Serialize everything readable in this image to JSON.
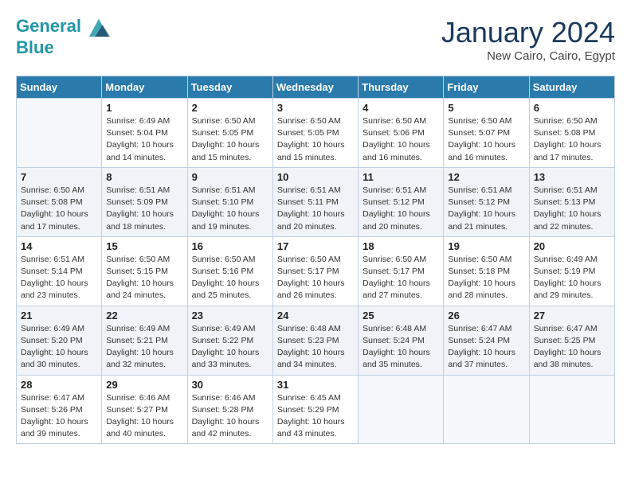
{
  "header": {
    "logo_line1": "General",
    "logo_line2": "Blue",
    "month_title": "January 2024",
    "location": "New Cairo, Cairo, Egypt"
  },
  "weekdays": [
    "Sunday",
    "Monday",
    "Tuesday",
    "Wednesday",
    "Thursday",
    "Friday",
    "Saturday"
  ],
  "weeks": [
    [
      {
        "day": "",
        "empty": true
      },
      {
        "day": "1",
        "sunrise": "6:49 AM",
        "sunset": "5:04 PM",
        "daylight": "10 hours and 14 minutes."
      },
      {
        "day": "2",
        "sunrise": "6:50 AM",
        "sunset": "5:05 PM",
        "daylight": "10 hours and 15 minutes."
      },
      {
        "day": "3",
        "sunrise": "6:50 AM",
        "sunset": "5:05 PM",
        "daylight": "10 hours and 15 minutes."
      },
      {
        "day": "4",
        "sunrise": "6:50 AM",
        "sunset": "5:06 PM",
        "daylight": "10 hours and 16 minutes."
      },
      {
        "day": "5",
        "sunrise": "6:50 AM",
        "sunset": "5:07 PM",
        "daylight": "10 hours and 16 minutes."
      },
      {
        "day": "6",
        "sunrise": "6:50 AM",
        "sunset": "5:08 PM",
        "daylight": "10 hours and 17 minutes."
      }
    ],
    [
      {
        "day": "7",
        "sunrise": "6:50 AM",
        "sunset": "5:08 PM",
        "daylight": "10 hours and 17 minutes."
      },
      {
        "day": "8",
        "sunrise": "6:51 AM",
        "sunset": "5:09 PM",
        "daylight": "10 hours and 18 minutes."
      },
      {
        "day": "9",
        "sunrise": "6:51 AM",
        "sunset": "5:10 PM",
        "daylight": "10 hours and 19 minutes."
      },
      {
        "day": "10",
        "sunrise": "6:51 AM",
        "sunset": "5:11 PM",
        "daylight": "10 hours and 20 minutes."
      },
      {
        "day": "11",
        "sunrise": "6:51 AM",
        "sunset": "5:12 PM",
        "daylight": "10 hours and 20 minutes."
      },
      {
        "day": "12",
        "sunrise": "6:51 AM",
        "sunset": "5:12 PM",
        "daylight": "10 hours and 21 minutes."
      },
      {
        "day": "13",
        "sunrise": "6:51 AM",
        "sunset": "5:13 PM",
        "daylight": "10 hours and 22 minutes."
      }
    ],
    [
      {
        "day": "14",
        "sunrise": "6:51 AM",
        "sunset": "5:14 PM",
        "daylight": "10 hours and 23 minutes."
      },
      {
        "day": "15",
        "sunrise": "6:50 AM",
        "sunset": "5:15 PM",
        "daylight": "10 hours and 24 minutes."
      },
      {
        "day": "16",
        "sunrise": "6:50 AM",
        "sunset": "5:16 PM",
        "daylight": "10 hours and 25 minutes."
      },
      {
        "day": "17",
        "sunrise": "6:50 AM",
        "sunset": "5:17 PM",
        "daylight": "10 hours and 26 minutes."
      },
      {
        "day": "18",
        "sunrise": "6:50 AM",
        "sunset": "5:17 PM",
        "daylight": "10 hours and 27 minutes."
      },
      {
        "day": "19",
        "sunrise": "6:50 AM",
        "sunset": "5:18 PM",
        "daylight": "10 hours and 28 minutes."
      },
      {
        "day": "20",
        "sunrise": "6:49 AM",
        "sunset": "5:19 PM",
        "daylight": "10 hours and 29 minutes."
      }
    ],
    [
      {
        "day": "21",
        "sunrise": "6:49 AM",
        "sunset": "5:20 PM",
        "daylight": "10 hours and 30 minutes."
      },
      {
        "day": "22",
        "sunrise": "6:49 AM",
        "sunset": "5:21 PM",
        "daylight": "10 hours and 32 minutes."
      },
      {
        "day": "23",
        "sunrise": "6:49 AM",
        "sunset": "5:22 PM",
        "daylight": "10 hours and 33 minutes."
      },
      {
        "day": "24",
        "sunrise": "6:48 AM",
        "sunset": "5:23 PM",
        "daylight": "10 hours and 34 minutes."
      },
      {
        "day": "25",
        "sunrise": "6:48 AM",
        "sunset": "5:24 PM",
        "daylight": "10 hours and 35 minutes."
      },
      {
        "day": "26",
        "sunrise": "6:47 AM",
        "sunset": "5:24 PM",
        "daylight": "10 hours and 37 minutes."
      },
      {
        "day": "27",
        "sunrise": "6:47 AM",
        "sunset": "5:25 PM",
        "daylight": "10 hours and 38 minutes."
      }
    ],
    [
      {
        "day": "28",
        "sunrise": "6:47 AM",
        "sunset": "5:26 PM",
        "daylight": "10 hours and 39 minutes."
      },
      {
        "day": "29",
        "sunrise": "6:46 AM",
        "sunset": "5:27 PM",
        "daylight": "10 hours and 40 minutes."
      },
      {
        "day": "30",
        "sunrise": "6:46 AM",
        "sunset": "5:28 PM",
        "daylight": "10 hours and 42 minutes."
      },
      {
        "day": "31",
        "sunrise": "6:45 AM",
        "sunset": "5:29 PM",
        "daylight": "10 hours and 43 minutes."
      },
      {
        "day": "",
        "empty": true
      },
      {
        "day": "",
        "empty": true
      },
      {
        "day": "",
        "empty": true
      }
    ]
  ]
}
